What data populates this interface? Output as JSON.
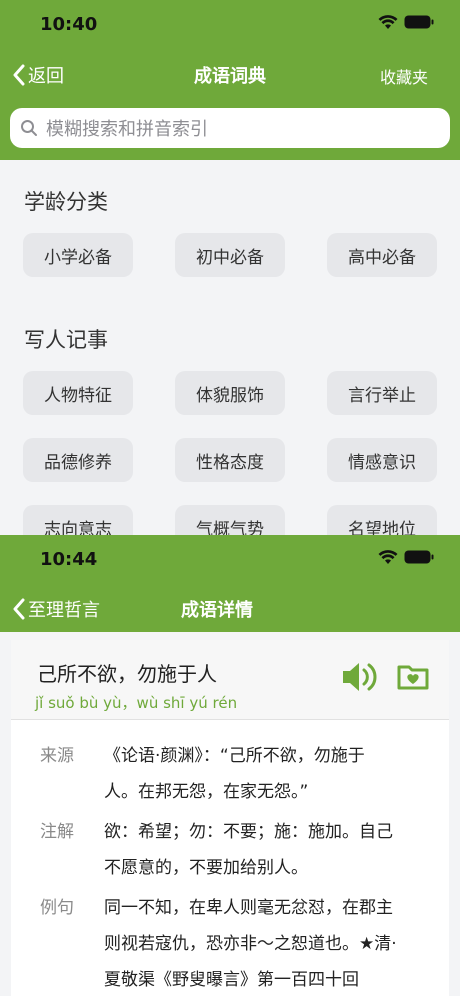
{
  "screen1": {
    "status_time": "10:40",
    "nav": {
      "back": "返回",
      "title": "成语词典",
      "right": "收藏夹"
    },
    "search_placeholder": "模糊搜索和拼音索引",
    "sections": [
      {
        "title": "学龄分类",
        "chips": [
          "小学必备",
          "初中必备",
          "高中必备"
        ]
      },
      {
        "title": "写人记事",
        "chips": [
          "人物特征",
          "体貌服饰",
          "言行举止",
          "品德修养",
          "性格态度",
          "情感意识",
          "志向意志",
          "气概气势",
          "名望地位"
        ]
      }
    ]
  },
  "screen2": {
    "status_time": "10:44",
    "nav": {
      "back": "至理哲言",
      "title": "成语详情"
    },
    "idiom": "己所不欲，勿施于人",
    "pinyin": "jǐ suǒ bù yù，wù shī yú rén",
    "rows": [
      {
        "label": "来源",
        "lines": [
          "《论语·颜渊》：“己所不欲，勿施于",
          "人。在邦无怨，在家无怨。”"
        ]
      },
      {
        "label": "注解",
        "lines": [
          "欲：希望；勿：不要；施：施加。自己",
          "不愿意的，不要加给别人。"
        ]
      },
      {
        "label": "例句",
        "lines": [
          "同一不知，在卑人则毫无忿怼，在郡主",
          "则视若寇仇，恐亦非～之恕道也。★清·",
          "夏敬渠《野叟曝言》第一百四十回"
        ]
      }
    ]
  },
  "colors": {
    "accent": "#6fa93a"
  }
}
